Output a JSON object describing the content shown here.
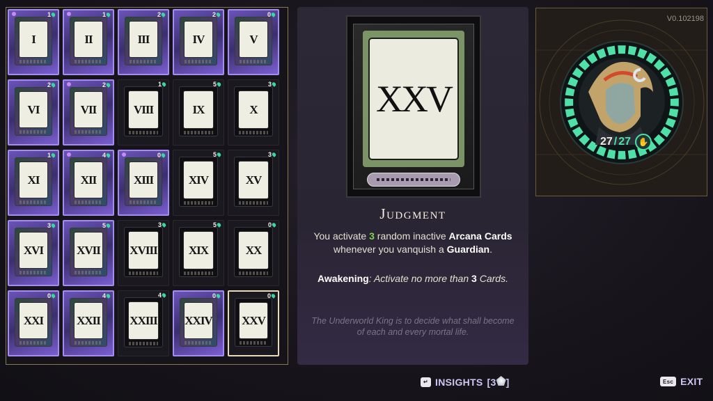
{
  "version": "V0.102198",
  "cards": [
    {
      "numeral": "I",
      "cost": "1",
      "active": true,
      "rarity": true
    },
    {
      "numeral": "II",
      "cost": "1",
      "active": true,
      "rarity": true
    },
    {
      "numeral": "III",
      "cost": "2",
      "active": true,
      "rarity": false
    },
    {
      "numeral": "IV",
      "cost": "2",
      "active": true,
      "rarity": false
    },
    {
      "numeral": "V",
      "cost": "0",
      "active": true,
      "rarity": false
    },
    {
      "numeral": "VI",
      "cost": "2",
      "active": true,
      "rarity": false
    },
    {
      "numeral": "VII",
      "cost": "2",
      "active": true,
      "rarity": true
    },
    {
      "numeral": "VIII",
      "cost": "1",
      "active": false,
      "rarity": false
    },
    {
      "numeral": "IX",
      "cost": "5",
      "active": false,
      "rarity": false
    },
    {
      "numeral": "X",
      "cost": "3",
      "active": false,
      "rarity": false
    },
    {
      "numeral": "XI",
      "cost": "1",
      "active": true,
      "rarity": false
    },
    {
      "numeral": "XII",
      "cost": "4",
      "active": true,
      "rarity": true
    },
    {
      "numeral": "XIII",
      "cost": "0",
      "active": true,
      "rarity": true
    },
    {
      "numeral": "XIV",
      "cost": "5",
      "active": false,
      "rarity": false
    },
    {
      "numeral": "XV",
      "cost": "3",
      "active": false,
      "rarity": false
    },
    {
      "numeral": "XVI",
      "cost": "3",
      "active": true,
      "rarity": false
    },
    {
      "numeral": "XVII",
      "cost": "5",
      "active": true,
      "rarity": false
    },
    {
      "numeral": "XVIII",
      "cost": "3",
      "active": false,
      "rarity": false
    },
    {
      "numeral": "XIX",
      "cost": "5",
      "active": false,
      "rarity": false
    },
    {
      "numeral": "XX",
      "cost": "0",
      "active": false,
      "rarity": false
    },
    {
      "numeral": "XXI",
      "cost": "0",
      "active": true,
      "rarity": false
    },
    {
      "numeral": "XXII",
      "cost": "4",
      "active": true,
      "rarity": false
    },
    {
      "numeral": "XXIII",
      "cost": "4",
      "active": false,
      "rarity": false
    },
    {
      "numeral": "XXIV",
      "cost": "0",
      "active": true,
      "rarity": false
    },
    {
      "numeral": "XXV",
      "cost": "0",
      "active": false,
      "rarity": false,
      "selected": true
    }
  ],
  "detail": {
    "numeral": "XXV",
    "title": "Judgment",
    "desc_pre": "You activate ",
    "desc_num": "3",
    "desc_mid": " random inactive ",
    "desc_b1": "Arcana Cards",
    "desc_mid2": " whenever you vanquish a ",
    "desc_b2": "Guardian",
    "desc_end": ".",
    "awaken_label": "Awakening",
    "awaken_text_pre": ": Activate no more than ",
    "awaken_num": "3",
    "awaken_text_post": " Cards.",
    "flavor": "The Underworld King is to decide what shall become of each and every mortal life."
  },
  "grasp": {
    "current": "27",
    "sep": "/",
    "max": "27",
    "ring_fill": 1.0,
    "accent": "#4fe0a8"
  },
  "buttons": {
    "insights_label": "INSIGHTS",
    "insights_open": "[",
    "insights_count": "3",
    "insights_close": "]",
    "insights_key": "↵",
    "exit_label": "EXIT",
    "exit_key": "Esc"
  },
  "colors": {
    "active_border": "#a58cf0",
    "selected_border": "#e8dcb8",
    "numeral_green": "#7bd84f"
  }
}
